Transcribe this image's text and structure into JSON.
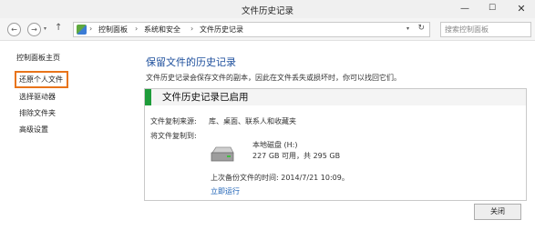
{
  "window": {
    "title": "文件历史记录",
    "min_glyph": "—",
    "max_glyph": "☐",
    "close_glyph": "✕"
  },
  "nav": {
    "back_glyph": "←",
    "forward_glyph": "→",
    "dropdown_glyph": "▾",
    "up_glyph": "↑",
    "breadcrumb": [
      "控制面板",
      "系统和安全",
      "文件历史记录"
    ],
    "separator": "›",
    "addr_dropdown_glyph": "▾",
    "refresh_glyph": "↻",
    "search_placeholder": "搜索控制面板"
  },
  "sidebar": {
    "home": "控制面板主页",
    "items": [
      "还原个人文件",
      "选择驱动器",
      "排除文件夹",
      "高级设置"
    ],
    "highlight_color": "#e8741a"
  },
  "main": {
    "heading": "保留文件的历史记录",
    "description": "文件历史记录会保存文件的副本，因此在文件丢失或损坏时，你可以找回它们。",
    "panel": {
      "status_title": "文件历史记录已启用",
      "status_color": "#1e9c3a",
      "source_label": "文件复制来源:",
      "source_value": "库、桌面、联系人和收藏夹",
      "dest_label": "将文件复制到:",
      "drive_icon": "drive-icon",
      "drive_name": "本地磁盘 (H:)",
      "drive_capacity": "227 GB 可用，共 295 GB",
      "last_backup": "上次备份文件的时间: 2014/7/21 10:09。",
      "run_now": "立即运行"
    },
    "close_button": "关闭"
  }
}
